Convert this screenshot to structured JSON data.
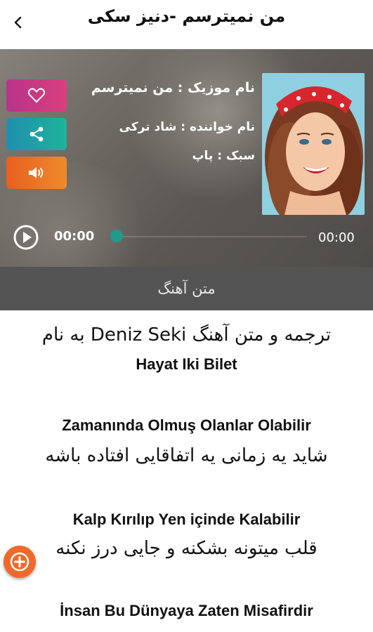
{
  "header": {
    "title": "من نمیترسم -دنیز سکی",
    "back_icon": "chevron-left-icon"
  },
  "player": {
    "song_name": "نام موزیک : من نمیترسم",
    "singer": "نام خواننده : شاد ترکی",
    "genre": "سبک : پاپ",
    "current_time": "00:00",
    "total_time": "00:00",
    "progress": 0,
    "buttons": [
      {
        "icon": "heart-icon",
        "color": "#c6368a"
      },
      {
        "icon": "share-icon",
        "color": "#1fa3a5"
      },
      {
        "icon": "volume-icon",
        "color": "#ec7127"
      }
    ]
  },
  "lyrics_tab": {
    "label": "متن آهنگ"
  },
  "lyrics": {
    "intro_1": "ترجمه و متن آهنگ Deniz Seki به نام",
    "intro_2": "Hayat Iki Bilet",
    "lines": [
      "Zamanında Olmuş Olanlar Olabilir",
      "شاید یه زمانی یه اتفاقایی افتاده باشه",
      "Kalp Kırılıp Yen içinde Kalabilir",
      "قلب میتونه بشکنه و جایی درز نکنه",
      "İnsan Bu Dünyaya Zaten Misafirdir"
    ]
  },
  "fab": {
    "icon": "plus-icon",
    "color": "#ef6a2a"
  }
}
